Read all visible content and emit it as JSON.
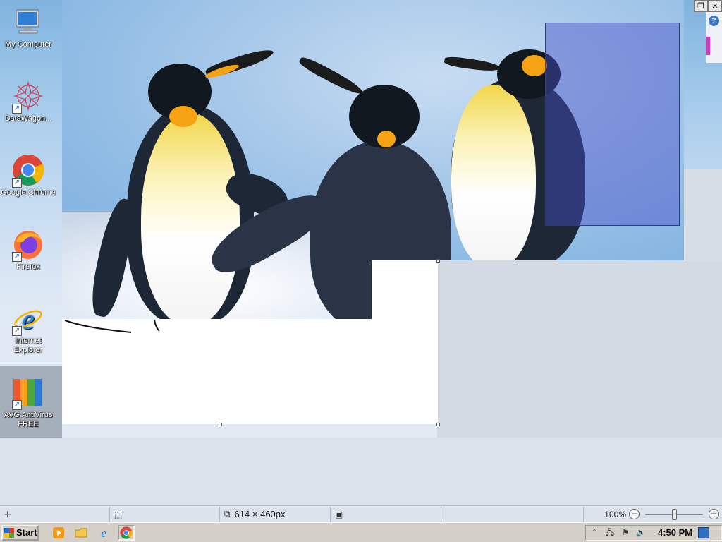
{
  "desktop": {
    "icons": [
      {
        "label": "My Computer",
        "icon": "my-computer-icon"
      },
      {
        "label": "DataWagon...",
        "icon": "datawagon-icon"
      },
      {
        "label": "Google Chrome",
        "icon": "chrome-icon"
      },
      {
        "label": "Firefox",
        "icon": "firefox-icon"
      },
      {
        "label": "Internet Explorer",
        "icon": "internet-explorer-icon"
      },
      {
        "label": "AVG AntiVirus FREE",
        "icon": "avg-icon"
      }
    ]
  },
  "window_controls": {
    "restore": "❐",
    "close": "✕",
    "help": "?"
  },
  "statusbar": {
    "dimensions": "614 × 460px",
    "zoom": "100%",
    "zoom_out": "−",
    "zoom_in": "+",
    "zoom_fraction": 0.5
  },
  "taskbar": {
    "start": "Start",
    "time": "4:50 PM",
    "tray_chevron": "˄"
  },
  "colors": {
    "selection_fill": "#4650c8",
    "taskbar_bg": "#d4d0c8",
    "statusbar_bg": "#dce3ec"
  }
}
